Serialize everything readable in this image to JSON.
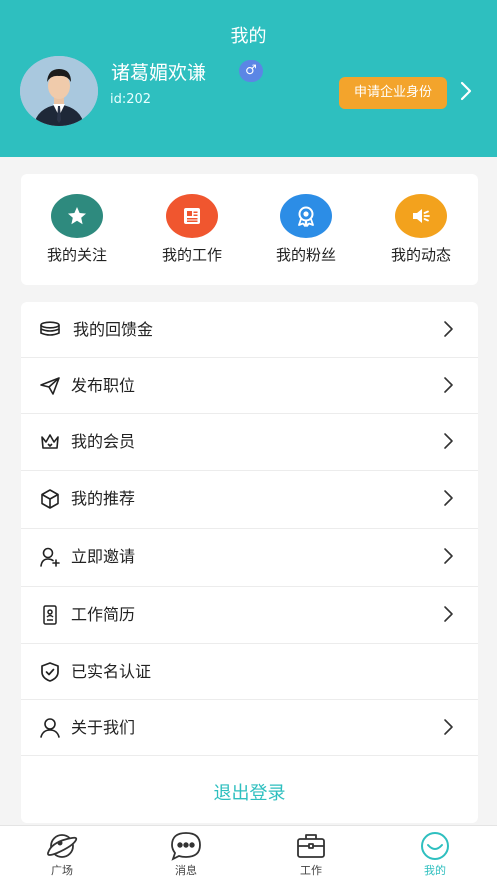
{
  "header": {
    "title": "我的",
    "username": "诸葛媚欢谦",
    "gender_symbol": "♂",
    "user_id": "id:202",
    "apply_button": "申请企业身份",
    "accent_color": "#2ebfbf"
  },
  "quick_actions": [
    {
      "label": "我的关注",
      "icon": "star-icon",
      "color": "#2e8a7e"
    },
    {
      "label": "我的工作",
      "icon": "document-icon",
      "color": "#f0562f"
    },
    {
      "label": "我的粉丝",
      "icon": "medal-icon",
      "color": "#2c8de6"
    },
    {
      "label": "我的动态",
      "icon": "speaker-icon",
      "color": "#f3a21d"
    }
  ],
  "menu": [
    {
      "label": "我的回馈金",
      "icon": "coins-icon",
      "chevron": true
    },
    {
      "label": "发布职位",
      "icon": "paper-plane-icon",
      "chevron": true
    },
    {
      "label": "我的会员",
      "icon": "crown-icon",
      "chevron": true
    },
    {
      "label": "我的推荐",
      "icon": "cube-icon",
      "chevron": true
    },
    {
      "label": "立即邀请",
      "icon": "user-add-icon",
      "chevron": true
    },
    {
      "label": "工作简历",
      "icon": "resume-icon",
      "chevron": true
    },
    {
      "label": "已实名认证",
      "icon": "shield-check-icon",
      "chevron": false
    },
    {
      "label": "关于我们",
      "icon": "person-icon",
      "chevron": true
    }
  ],
  "logout_label": "退出登录",
  "tabs": [
    {
      "label": "广场",
      "icon": "planet-icon",
      "active": false
    },
    {
      "label": "消息",
      "icon": "chat-icon",
      "active": false
    },
    {
      "label": "工作",
      "icon": "briefcase-icon",
      "active": false
    },
    {
      "label": "我的",
      "icon": "smile-icon",
      "active": true
    }
  ]
}
